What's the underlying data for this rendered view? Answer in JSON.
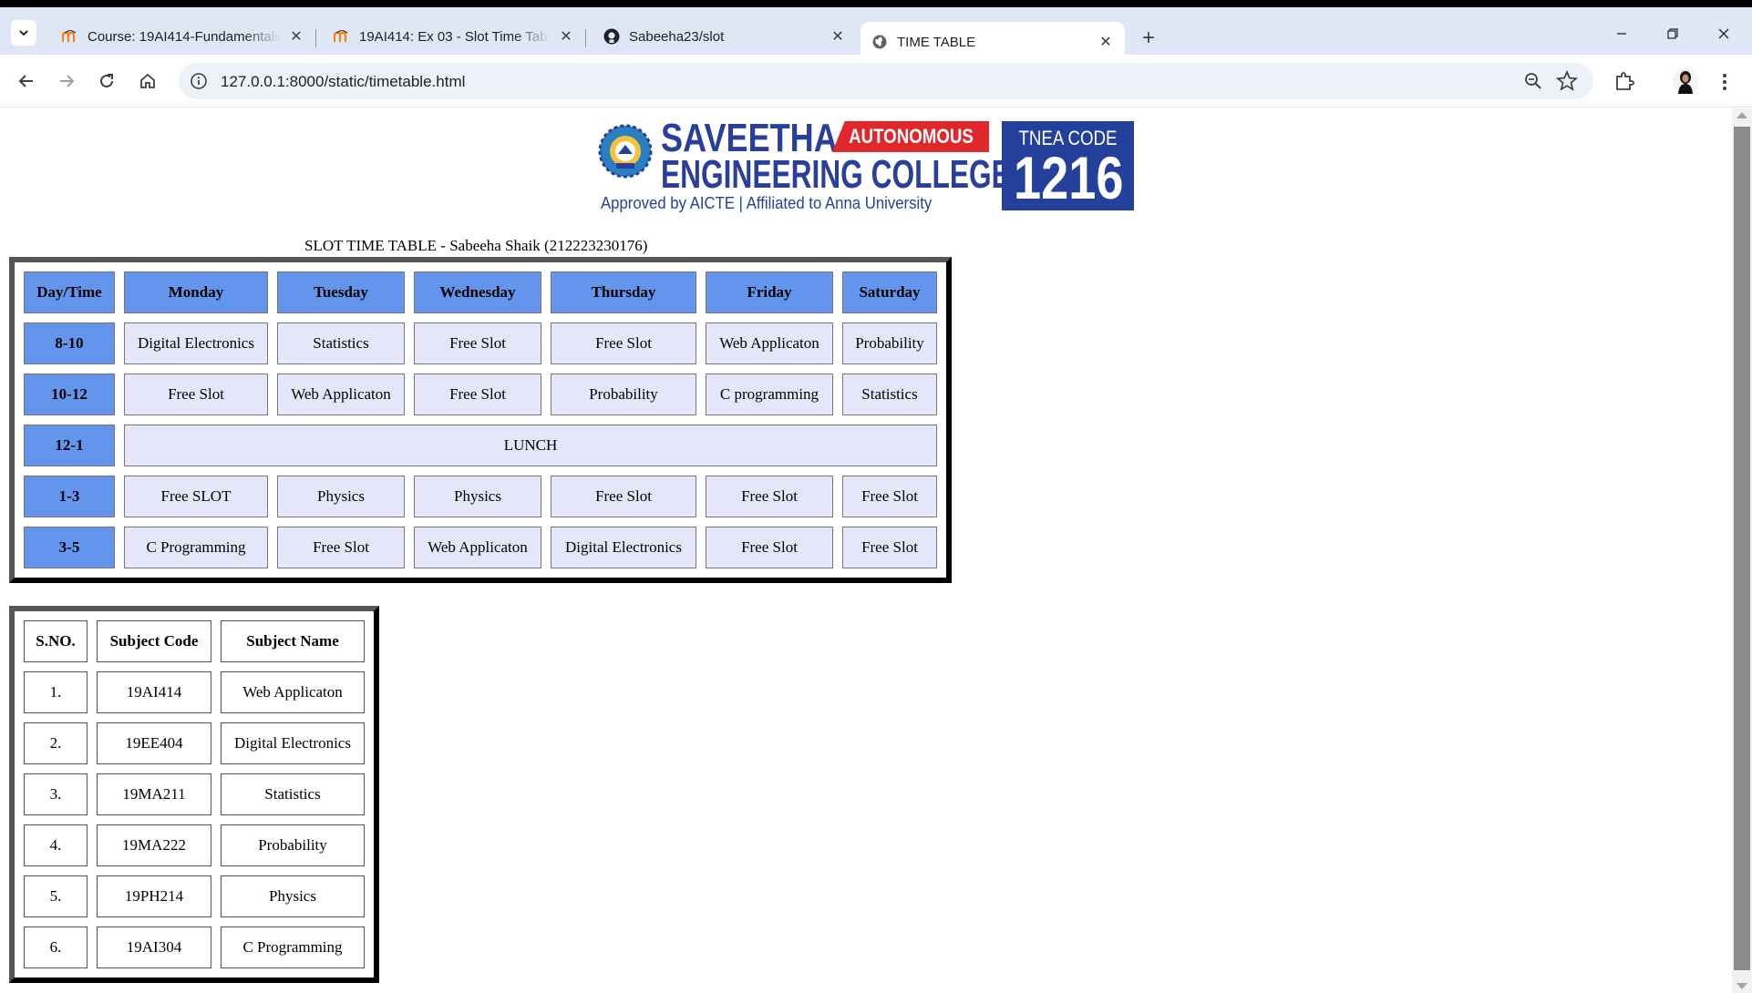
{
  "browser": {
    "tabs": [
      {
        "title": "Course: 19AI414-Fundamentals",
        "favicon": "moodle-icon",
        "active": false
      },
      {
        "title": "19AI414: Ex 03 - Slot Time Table",
        "favicon": "moodle-icon",
        "active": false
      },
      {
        "title": "Sabeeha23/slot",
        "favicon": "github-icon",
        "active": false
      },
      {
        "title": "TIME TABLE",
        "favicon": "globe-icon",
        "active": true
      }
    ],
    "url": "127.0.0.1:8000/static/timetable.html"
  },
  "logo": {
    "name_line1": "SAVEETHA",
    "badge": "AUTONOMOUS",
    "name_line2": "ENGINEERING COLLEGE",
    "affiliation": "Approved by AICTE  |  Affiliated to Anna University",
    "code_label": "TNEA CODE",
    "code_number": "1216"
  },
  "caption": "SLOT TIME TABLE - Sabeeha Shaik (212223230176)",
  "timetable": {
    "headers": [
      "Day/Time",
      "Monday",
      "Tuesday",
      "Wednesday",
      "Thursday",
      "Friday",
      "Saturday"
    ],
    "rows": [
      {
        "time": "8-10",
        "cells": [
          "Digital Electronics",
          "Statistics",
          "Free Slot",
          "Free Slot",
          "Web Applicaton",
          "Probability"
        ]
      },
      {
        "time": "10-12",
        "cells": [
          "Free Slot",
          "Web Applicaton",
          "Free Slot",
          "Probability",
          "C programming",
          "Statistics"
        ]
      },
      {
        "time": "12-1",
        "lunch": "LUNCH"
      },
      {
        "time": "1-3",
        "cells": [
          "Free SLOT",
          "Physics",
          "Physics",
          "Free Slot",
          "Free Slot",
          "Free Slot"
        ]
      },
      {
        "time": "3-5",
        "cells": [
          "C Programming",
          "Free Slot",
          "Web Applicaton",
          "Digital Electronics",
          "Free Slot",
          "Free Slot"
        ]
      }
    ]
  },
  "subjects": {
    "headers": [
      "S.NO.",
      "Subject Code",
      "Subject Name"
    ],
    "rows": [
      [
        "1.",
        "19AI414",
        "Web Applicaton"
      ],
      [
        "2.",
        "19EE404",
        "Digital Electronics"
      ],
      [
        "3.",
        "19MA211",
        "Statistics"
      ],
      [
        "4.",
        "19MA222",
        "Probability"
      ],
      [
        "5.",
        "19PH214",
        "Physics"
      ],
      [
        "6.",
        "19AI304",
        "C Programming"
      ]
    ]
  },
  "colors": {
    "header_blue": "#6495ed",
    "cell_lavender": "#e6e6fa",
    "logo_blue": "#2a3f9a",
    "logo_red": "#e0282c"
  }
}
